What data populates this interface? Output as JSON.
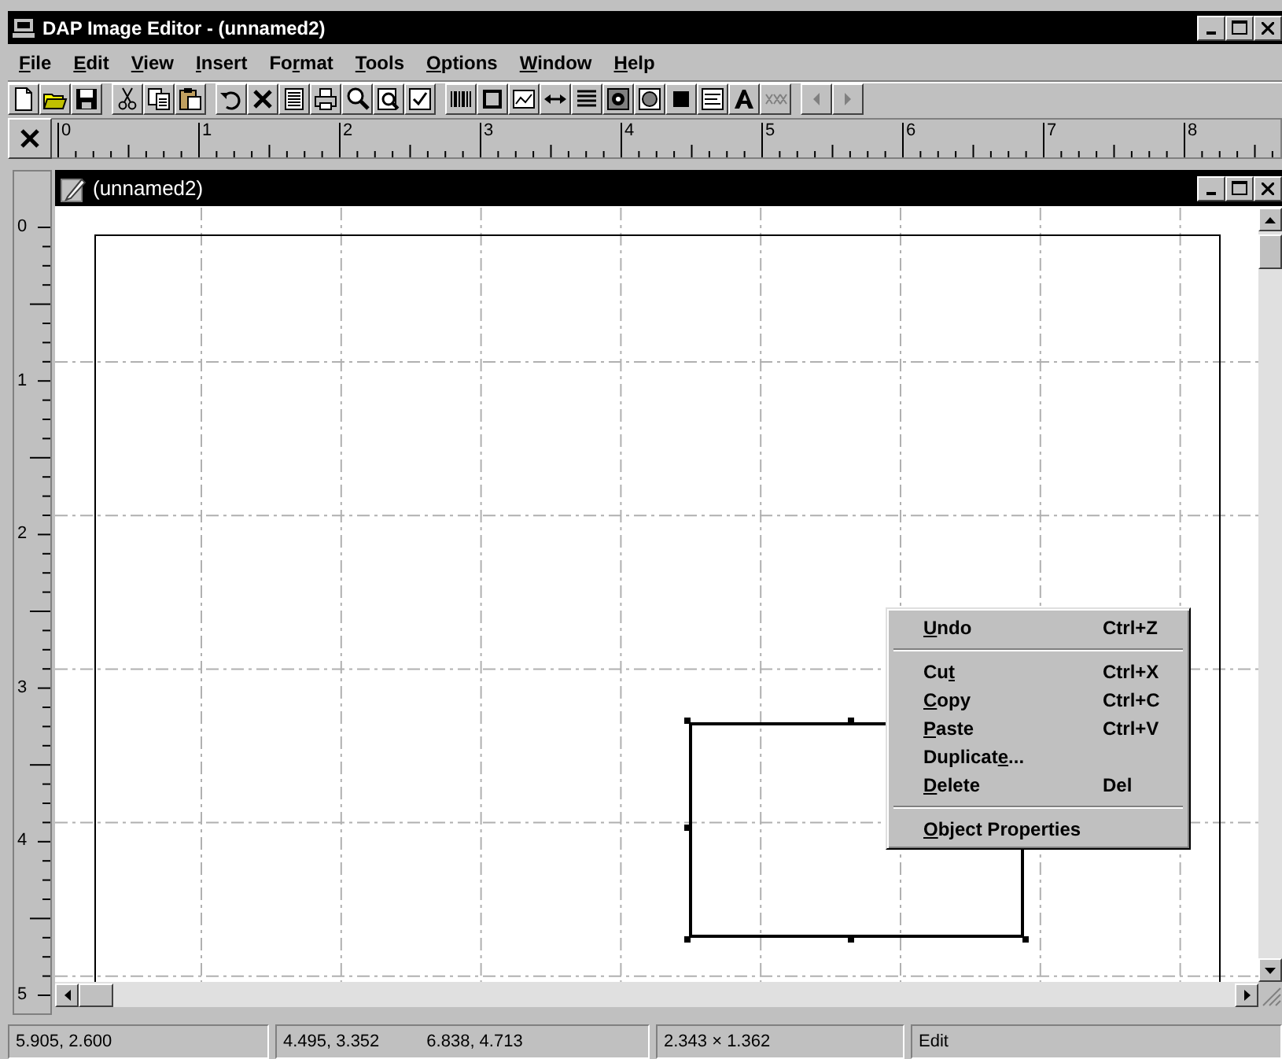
{
  "window": {
    "title": "DAP Image Editor - (unnamed2)"
  },
  "menu": [
    {
      "key": "F",
      "post": "ile"
    },
    {
      "key": "E",
      "post": "dit"
    },
    {
      "key": "V",
      "post": "iew"
    },
    {
      "key": "I",
      "post": "nsert"
    },
    {
      "pre": "Fo",
      "key": "r",
      "post": "mat"
    },
    {
      "key": "T",
      "post": "ools"
    },
    {
      "key": "O",
      "post": "ptions"
    },
    {
      "key": "W",
      "post": "indow"
    },
    {
      "key": "H",
      "post": "elp"
    }
  ],
  "toolbar": [
    [
      {
        "kind": "new",
        "disabled": false
      },
      {
        "kind": "open",
        "disabled": false
      },
      {
        "kind": "save",
        "disabled": false
      }
    ],
    [
      {
        "kind": "cut",
        "disabled": false
      },
      {
        "kind": "copy",
        "disabled": false
      },
      {
        "kind": "paste",
        "disabled": false
      }
    ],
    [
      {
        "kind": "undo",
        "disabled": false
      },
      {
        "kind": "delete",
        "disabled": false
      },
      {
        "kind": "list",
        "disabled": false
      },
      {
        "kind": "print",
        "disabled": false
      },
      {
        "kind": "zoom",
        "disabled": false
      },
      {
        "kind": "zoompage",
        "disabled": false
      },
      {
        "kind": "check",
        "disabled": false
      }
    ],
    [
      {
        "kind": "barcode",
        "disabled": false
      },
      {
        "kind": "rect",
        "disabled": false
      },
      {
        "kind": "chart",
        "disabled": false
      },
      {
        "kind": "resize",
        "disabled": false
      },
      {
        "kind": "lines",
        "disabled": false
      },
      {
        "kind": "image",
        "disabled": false
      },
      {
        "kind": "face",
        "disabled": false
      },
      {
        "kind": "fill",
        "disabled": false
      },
      {
        "kind": "textbox",
        "disabled": false
      },
      {
        "kind": "font",
        "disabled": false
      },
      {
        "kind": "pattern",
        "disabled": true
      }
    ],
    [
      {
        "kind": "left",
        "disabled": true
      },
      {
        "kind": "right",
        "disabled": true
      }
    ]
  ],
  "rulers": {
    "horizontal": [
      "0",
      "1",
      "2",
      "3",
      "4",
      "5",
      "6",
      "7",
      "8"
    ],
    "vertical": [
      "0",
      "1",
      "2",
      "3",
      "4",
      "5"
    ]
  },
  "document": {
    "title": "(unnamed2)"
  },
  "context_menu": {
    "groups": [
      {
        "items": [
          {
            "label": {
              "key": "U",
              "post": "ndo"
            },
            "shortcut": "Ctrl+Z"
          }
        ]
      },
      {
        "items": [
          {
            "label": {
              "pre": "Cu",
              "key": "t"
            },
            "shortcut": "Ctrl+X"
          },
          {
            "label": {
              "key": "C",
              "post": "opy"
            },
            "shortcut": "Ctrl+C"
          },
          {
            "label": {
              "key": "P",
              "post": "aste"
            },
            "shortcut": "Ctrl+V"
          },
          {
            "label": {
              "pre": "Duplicat",
              "key": "e",
              "post": "..."
            }
          },
          {
            "label": {
              "key": "D",
              "post": "elete"
            },
            "shortcut": "Del"
          }
        ]
      },
      {
        "items": [
          {
            "label": {
              "key": "O",
              "post": "bject Properties"
            }
          }
        ]
      }
    ]
  },
  "status_bar": [
    {
      "texts": [
        "5.905, 2.600"
      ]
    },
    {
      "texts": [
        "4.495, 3.352",
        "6.838, 4.713"
      ]
    },
    {
      "texts": [
        "2.343 × 1.362"
      ]
    },
    {
      "texts": [
        "Edit"
      ]
    }
  ]
}
